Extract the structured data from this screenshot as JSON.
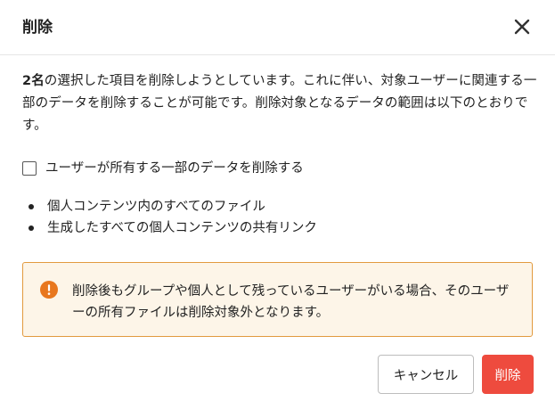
{
  "dialog": {
    "title": "削除",
    "close_icon": "close-icon"
  },
  "description": {
    "count": "2名",
    "text": "の選択した項目を削除しようとしています。これに伴い、対象ユーザーに関連する一部のデータを削除することが可能です。削除対象となるデータの範囲は以下のとおりです。"
  },
  "checkbox": {
    "label": "ユーザーが所有する一部のデータを削除する",
    "checked": false
  },
  "bullets": [
    "個人コンテンツ内のすべてのファイル",
    "生成したすべての個人コンテンツの共有リンク"
  ],
  "warning": {
    "icon": "exclamation-icon",
    "text": "削除後もグループや個人として残っているユーザーがいる場合、そのユーザーの所有ファイルは削除対象外となります。",
    "accent_color": "#e8771e"
  },
  "buttons": {
    "cancel_label": "キャンセル",
    "delete_label": "削除",
    "delete_color": "#ee4b3e"
  }
}
